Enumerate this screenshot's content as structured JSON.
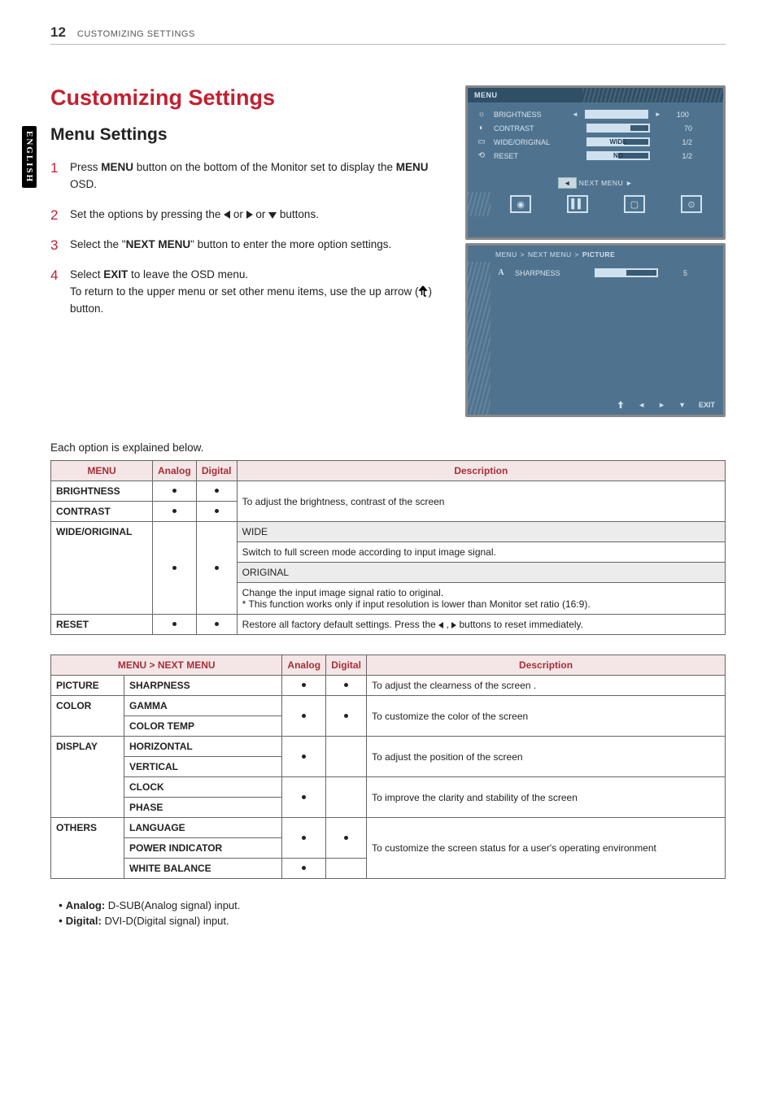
{
  "header": {
    "page_number": "12",
    "section": "CUSTOMIZING SETTINGS"
  },
  "language_tab": "ENGLISH",
  "title": "Customizing Settings",
  "subtitle": "Menu Settings",
  "steps": {
    "s1a": "Press ",
    "s1b": "MENU",
    "s1c": " button on the bottom of the Monitor set to display the ",
    "s1d": "MENU",
    "s1e": " OSD.",
    "s2a": "Set the options by pressing the ",
    "s2b": " or ",
    "s2c": " or ",
    "s2d": " buttons.",
    "s3a": "Select the \"",
    "s3b": "NEXT MENU",
    "s3c": "\" button to enter the more option settings.",
    "s4a": "Select ",
    "s4b": "EXIT",
    "s4c": " to leave the OSD menu.",
    "s4d": "To return to the upper menu or set other menu items, use the up arrow (",
    "s4e": ") button."
  },
  "osd": {
    "menu_label": "MENU",
    "rows": {
      "brightness": {
        "label": "BRIGHTNESS",
        "value": "100"
      },
      "contrast": {
        "label": "CONTRAST",
        "value": "70"
      },
      "wide": {
        "label": "WIDE/ORIGINAL",
        "text": "WIDE",
        "value": "1/2"
      },
      "reset": {
        "label": "RESET",
        "text": "NO",
        "value": "1/2"
      }
    },
    "next_menu": "NEXT MENU",
    "breadcrumb": {
      "a": "MENU",
      "b": "NEXT MENU",
      "c": "PICTURE"
    },
    "sharpness": {
      "label": "SHARPNESS",
      "value": "5"
    },
    "exit": "EXIT"
  },
  "note": "Each option is explained below.",
  "table1": {
    "head": {
      "menu": "MENU",
      "analog": "Analog",
      "digital": "Digital",
      "desc": "Description"
    },
    "brightness": "BRIGHTNESS",
    "contrast": "CONTRAST",
    "desc_bc": "To adjust the brightness, contrast of the screen",
    "wide_orig": "WIDE/ORIGINAL",
    "wide": "WIDE",
    "wide_desc": "Switch to full screen mode according to input image signal.",
    "original": "ORIGINAL",
    "original_desc_a": "Change the input image signal ratio to original.",
    "original_desc_b": "* This function works only if input resolution is lower than Monitor set ratio (16:9).",
    "reset": "RESET",
    "reset_desc_a": "Restore all factory default settings. Press the ",
    "reset_desc_b": " , ",
    "reset_desc_c": "    buttons to reset immediately."
  },
  "table2": {
    "head": {
      "menu": "MENU > NEXT MENU",
      "analog": "Analog",
      "digital": "Digital",
      "desc": "Description"
    },
    "picture": "PICTURE",
    "sharpness": "SHARPNESS",
    "sharpness_desc": "To adjust the clearness of the screen .",
    "color": "COLOR",
    "gamma": "GAMMA",
    "color_temp": "COLOR TEMP",
    "color_desc": "To customize the color of the screen",
    "display": "DISPLAY",
    "horizontal": "HORIZONTAL",
    "vertical": "VERTICAL",
    "display_desc": "To adjust the position of the screen",
    "clock": "CLOCK",
    "phase": "PHASE",
    "clock_desc": "To improve the clarity and stability of the screen",
    "others": "OTHERS",
    "language": "LANGUAGE",
    "power_indicator": "POWER INDICATOR",
    "others_desc": "To customize the screen status for a user's operating environment",
    "white_balance": "WHITE BALANCE"
  },
  "legend": {
    "analog_label": "Analog:",
    "analog_text": " D-SUB(Analog signal) input.",
    "digital_label": "Digital:",
    "digital_text": " DVI-D(Digital signal) input."
  }
}
